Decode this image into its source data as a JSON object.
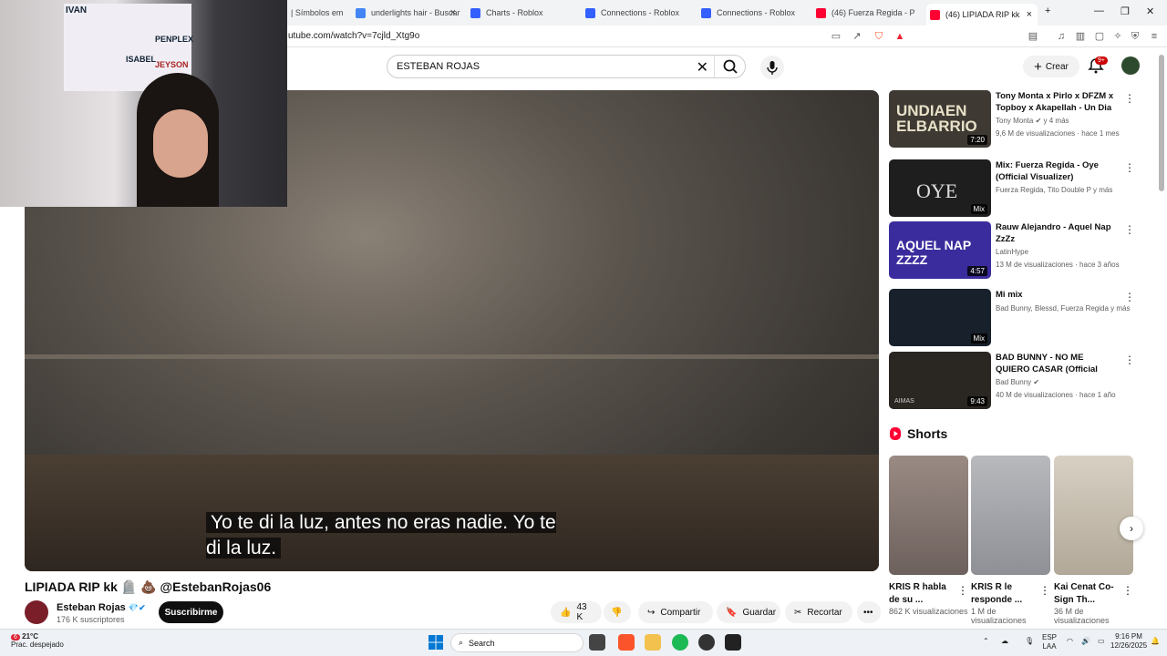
{
  "browser": {
    "tabs": [
      {
        "label": "| Símbolos em",
        "active": false
      },
      {
        "label": "underlights hair - Buscar",
        "active": false
      },
      {
        "label": "Charts - Roblox",
        "active": false
      },
      {
        "label": "Connections - Roblox",
        "active": false
      },
      {
        "label": "Connections - Roblox",
        "active": false
      },
      {
        "label": "(46) Fuerza Regida - P",
        "active": false
      },
      {
        "label": "(46) LIPIADA RIP kk",
        "active": true
      }
    ],
    "url": "utube.com/watch?v=7cjld_Xtg9o"
  },
  "youtube": {
    "search_query": "ESTEBAN ROJAS",
    "create_label": "Crear",
    "notif_count": "9+",
    "caption": "Yo te di la luz, antes no eras nadie. Yo te di la luz.",
    "video_title": "LIPIADA RIP kk 🪦 💩 @EstebanRojas06",
    "channel_name": "Esteban Rojas",
    "channel_subs": "176 K suscriptores",
    "subscribe_label": "Suscribirme",
    "like_count": "43 K",
    "share_label": "Compartir",
    "save_label": "Guardar",
    "clip_label": "Recortar",
    "webcam_poster": {
      "name1": "IVAN",
      "name2": "ISABEL",
      "name3": "PENPLEX",
      "name4": "JEYSON"
    }
  },
  "recommendations": [
    {
      "title": "Tony Monta x Pirlo x DFZM x Topboy x Akapellah - Un Dia E...",
      "channel": "Tony Monta ✔ y 4 más",
      "meta": "9,6 M de visualizaciones · hace 1 mes",
      "duration": "7:20",
      "thumb_color": "#3e3a33",
      "thumb_text": "UNDIAEN ELBARRIO"
    },
    {
      "title": "Mix: Fuerza Regida - Oye (Official Visualizer)",
      "channel": "Fuerza Regida, Tito Double P y más",
      "meta": "",
      "duration": "Mix",
      "thumb_color": "#1e1e1e",
      "thumb_text": "OYE"
    },
    {
      "title": "Rauw Alejandro - Aquel Nap ZzZz",
      "channel": "LatinHype",
      "meta": "13 M de visualizaciones · hace 3 años",
      "duration": "4:57",
      "thumb_color": "#3b2c9e",
      "thumb_text": "AQUEL NAP ZZZZ"
    },
    {
      "title": "Mi mix",
      "channel": "Bad Bunny, Blessd, Fuerza Regida y más",
      "meta": "",
      "duration": "Mix",
      "thumb_color": "#17202b",
      "thumb_text": ""
    },
    {
      "title": "BAD BUNNY - NO ME QUIERO CASAR (Official Video) | nadie ...",
      "channel": "Bad Bunny ✔",
      "meta": "40 M de visualizaciones · hace 1 año",
      "duration": "9:43",
      "thumb_color": "#2a2622",
      "thumb_text": "AIMAS"
    }
  ],
  "shorts": {
    "heading": "Shorts",
    "items": [
      {
        "title": "KRIS R habla de su ...",
        "views": "862 K visualizaciones",
        "color": "#8d7e78"
      },
      {
        "title": "KRIS R le responde ...",
        "views": "1 M de visualizaciones",
        "color": "#a4a6ab"
      },
      {
        "title": "Kai Cenat Co-Sign Th...",
        "views": "36 M de visualizaciones",
        "color": "#c9c1b4"
      }
    ]
  },
  "taskbar": {
    "weather_badge": "6",
    "temp": "21°C",
    "weather_desc": "Prac. despejado",
    "search_label": "Search",
    "lang1": "ESP",
    "lang2": "LAA",
    "time": "9:16 PM",
    "date": "12/26/2025"
  },
  "colors": {
    "yt_red": "#ff0033",
    "subscribe_bg": "#0f0f0f",
    "pill_bg": "#f2f2f2"
  }
}
